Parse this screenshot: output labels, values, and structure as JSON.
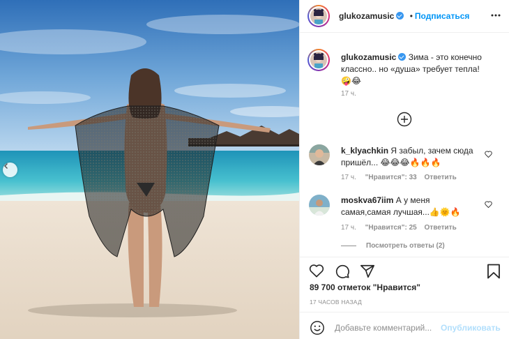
{
  "post": {
    "username": "glukozamusic",
    "follow_label": "Подписаться",
    "separator": "•"
  },
  "caption": {
    "username": "glukozamusic",
    "text": "Зима - это конечно классно.. но «душа» требует тепла!",
    "emoji": "🤪😂",
    "time": "17 ч."
  },
  "comments": [
    {
      "username": "k_klyachkin",
      "text": "Я забыл, зачем сюда пришёл... 😂😂😂🔥🔥🔥",
      "time": "17 ч.",
      "likes": "\"Нравится\": 33",
      "reply": "Ответить"
    },
    {
      "username": "moskva67iim",
      "text": "А у меня самая,самая лучшая...👍🌞🔥",
      "time": "17 ч.",
      "likes": "\"Нравится\": 25",
      "reply": "Ответить"
    }
  ],
  "view_replies": "Посмотреть ответы (2)",
  "likes_count": "89 700 отметок \"Нравится\"",
  "posted_ago": "17 ЧАСОВ НАЗАД",
  "comment_input": {
    "placeholder": "Добавьте комментарий...",
    "publish_label": "Опубликовать"
  },
  "icons": {
    "more": "more-options-icon",
    "plus": "load-more-icon",
    "like": "heart-icon",
    "comment": "comment-icon",
    "share": "share-icon",
    "save": "bookmark-icon",
    "emoji": "emoji-icon",
    "prev": "chevron-left-icon",
    "verified": "verified-badge-icon"
  },
  "colors": {
    "link_blue": "#0095f6",
    "publish_disabled": "#b2dffc",
    "muted_text": "#8e8e8e",
    "text": "#262626",
    "border": "#efefef"
  }
}
